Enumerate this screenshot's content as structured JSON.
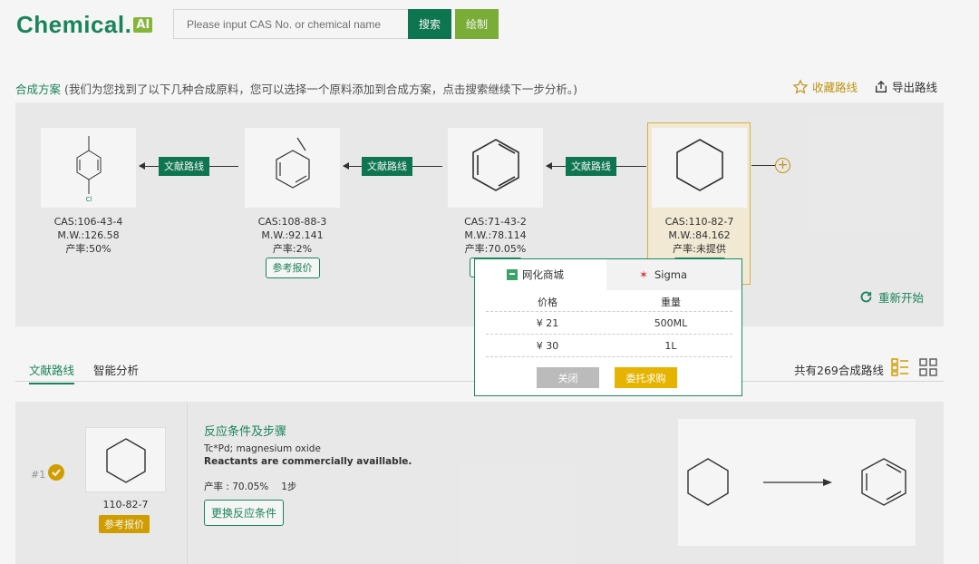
{
  "header": {
    "logo_text": "Chemical.",
    "logo_badge": "AI",
    "search_placeholder": "Please input CAS No. or chemical name",
    "search_button": "搜索",
    "draw_button": "绘制"
  },
  "synthesis": {
    "title": "合成方案",
    "hint": " (我们为您找到了以下几种合成原料，您可以选择一个原料添加到合成方案，点击搜索继续下一步分析。)",
    "save_route": "收藏路线",
    "export_route": "导出路线",
    "route_tag": "文献路线",
    "ref_price": "参考报价",
    "restart": "重新开始",
    "nodes": [
      {
        "cas": "CAS:106-43-4",
        "mw": "M.W.:126.58",
        "yield": "产率:50%",
        "atom": "Cl"
      },
      {
        "cas": "CAS:108-88-3",
        "mw": "M.W.:92.141",
        "yield": "产率:2%"
      },
      {
        "cas": "CAS:71-43-2",
        "mw": "M.W.:78.114",
        "yield": "产率:70.05%"
      },
      {
        "cas": "CAS:110-82-7",
        "mw": "M.W.:84.162",
        "yield": "产率:未提供"
      }
    ]
  },
  "tabs": {
    "tab1": "文献路线",
    "tab2": "智能分析",
    "count": "共有269合成路线"
  },
  "result": {
    "index": "#1",
    "cas": "110-82-7",
    "ref_price": "参考报价",
    "cond_title": "反应条件及步骤",
    "conditions": "Tc*Pd; magnesium oxide",
    "note": "Reactants are commercially availlable.",
    "yield": "产率 : 70.05%",
    "steps": "1步",
    "change_button": "更换反应条件"
  },
  "popup": {
    "tab1": "网化商城",
    "tab2": "Sigma",
    "col_price": "价格",
    "col_weight": "重量",
    "rows": [
      {
        "price": "¥ 21",
        "weight": "500ML"
      },
      {
        "price": "¥ 30",
        "weight": "1L"
      }
    ],
    "close": "关闭",
    "buy": "委托求购"
  }
}
